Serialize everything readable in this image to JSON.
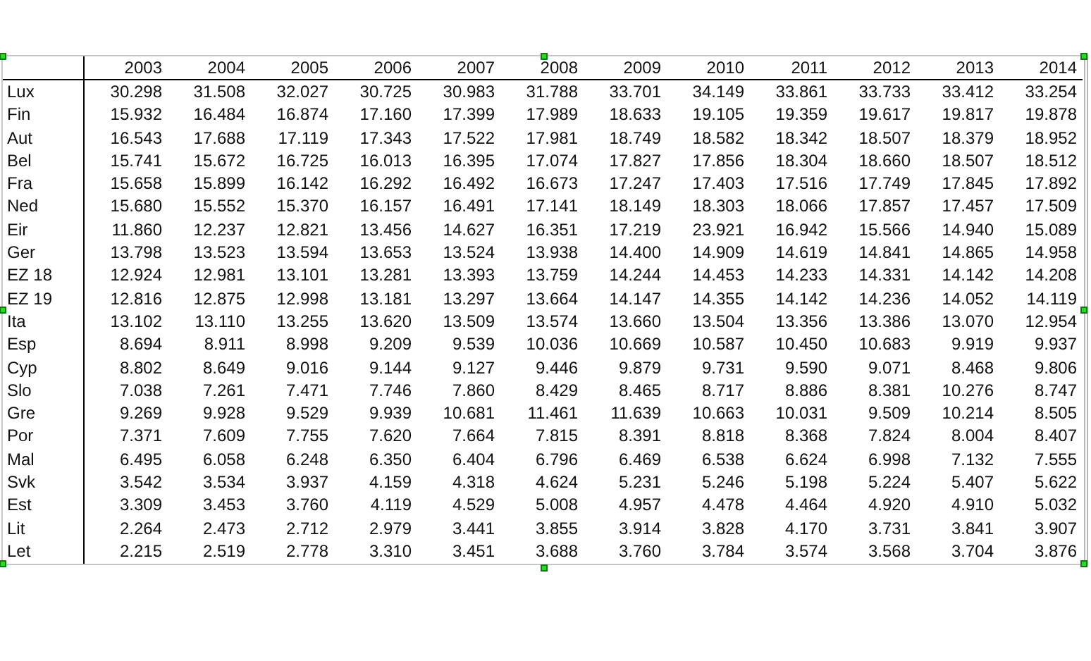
{
  "table": {
    "columns": [
      "2003",
      "2004",
      "2005",
      "2006",
      "2007",
      "2008",
      "2009",
      "2010",
      "2011",
      "2012",
      "2013",
      "2014"
    ],
    "rows": [
      {
        "label": "Lux",
        "cells": [
          "30.298",
          "31.508",
          "32.027",
          "30.725",
          "30.983",
          "31.788",
          "33.701",
          "34.149",
          "33.861",
          "33.733",
          "33.412",
          "33.254"
        ]
      },
      {
        "label": "Fin",
        "cells": [
          "15.932",
          "16.484",
          "16.874",
          "17.160",
          "17.399",
          "17.989",
          "18.633",
          "19.105",
          "19.359",
          "19.617",
          "19.817",
          "19.878"
        ]
      },
      {
        "label": "Aut",
        "cells": [
          "16.543",
          "17.688",
          "17.119",
          "17.343",
          "17.522",
          "17.981",
          "18.749",
          "18.582",
          "18.342",
          "18.507",
          "18.379",
          "18.952"
        ]
      },
      {
        "label": "Bel",
        "cells": [
          "15.741",
          "15.672",
          "16.725",
          "16.013",
          "16.395",
          "17.074",
          "17.827",
          "17.856",
          "18.304",
          "18.660",
          "18.507",
          "18.512"
        ]
      },
      {
        "label": "Fra",
        "cells": [
          "15.658",
          "15.899",
          "16.142",
          "16.292",
          "16.492",
          "16.673",
          "17.247",
          "17.403",
          "17.516",
          "17.749",
          "17.845",
          "17.892"
        ]
      },
      {
        "label": "Ned",
        "cells": [
          "15.680",
          "15.552",
          "15.370",
          "16.157",
          "16.491",
          "17.141",
          "18.149",
          "18.303",
          "18.066",
          "17.857",
          "17.457",
          "17.509"
        ]
      },
      {
        "label": "Eir",
        "cells": [
          "11.860",
          "12.237",
          "12.821",
          "13.456",
          "14.627",
          "16.351",
          "17.219",
          "23.921",
          "16.942",
          "15.566",
          "14.940",
          "15.089"
        ]
      },
      {
        "label": "Ger",
        "cells": [
          "13.798",
          "13.523",
          "13.594",
          "13.653",
          "13.524",
          "13.938",
          "14.400",
          "14.909",
          "14.619",
          "14.841",
          "14.865",
          "14.958"
        ]
      },
      {
        "label": "EZ 18",
        "cells": [
          "12.924",
          "12.981",
          "13.101",
          "13.281",
          "13.393",
          "13.759",
          "14.244",
          "14.453",
          "14.233",
          "14.331",
          "14.142",
          "14.208"
        ]
      },
      {
        "label": "EZ 19",
        "cells": [
          "12.816",
          "12.875",
          "12.998",
          "13.181",
          "13.297",
          "13.664",
          "14.147",
          "14.355",
          "14.142",
          "14.236",
          "14.052",
          "14.119"
        ]
      },
      {
        "label": "Ita",
        "cells": [
          "13.102",
          "13.110",
          "13.255",
          "13.620",
          "13.509",
          "13.574",
          "13.660",
          "13.504",
          "13.356",
          "13.386",
          "13.070",
          "12.954"
        ]
      },
      {
        "label": "Esp",
        "cells": [
          "8.694",
          "8.911",
          "8.998",
          "9.209",
          "9.539",
          "10.036",
          "10.669",
          "10.587",
          "10.450",
          "10.683",
          "9.919",
          "9.937"
        ]
      },
      {
        "label": "Cyp",
        "cells": [
          "8.802",
          "8.649",
          "9.016",
          "9.144",
          "9.127",
          "9.446",
          "9.879",
          "9.731",
          "9.590",
          "9.071",
          "8.468",
          "9.806"
        ]
      },
      {
        "label": "Slo",
        "cells": [
          "7.038",
          "7.261",
          "7.471",
          "7.746",
          "7.860",
          "8.429",
          "8.465",
          "8.717",
          "8.886",
          "8.381",
          "10.276",
          "8.747"
        ]
      },
      {
        "label": "Gre",
        "cells": [
          "9.269",
          "9.928",
          "9.529",
          "9.939",
          "10.681",
          "11.461",
          "11.639",
          "10.663",
          "10.031",
          "9.509",
          "10.214",
          "8.505"
        ]
      },
      {
        "label": "Por",
        "cells": [
          "7.371",
          "7.609",
          "7.755",
          "7.620",
          "7.664",
          "7.815",
          "8.391",
          "8.818",
          "8.368",
          "7.824",
          "8.004",
          "8.407"
        ]
      },
      {
        "label": "Mal",
        "cells": [
          "6.495",
          "6.058",
          "6.248",
          "6.350",
          "6.404",
          "6.796",
          "6.469",
          "6.538",
          "6.624",
          "6.998",
          "7.132",
          "7.555"
        ]
      },
      {
        "label": "Svk",
        "cells": [
          "3.542",
          "3.534",
          "3.937",
          "4.159",
          "4.318",
          "4.624",
          "5.231",
          "5.246",
          "5.198",
          "5.224",
          "5.407",
          "5.622"
        ]
      },
      {
        "label": "Est",
        "cells": [
          "3.309",
          "3.453",
          "3.760",
          "4.119",
          "4.529",
          "5.008",
          "4.957",
          "4.478",
          "4.464",
          "4.920",
          "4.910",
          "5.032"
        ]
      },
      {
        "label": "Lit",
        "cells": [
          "2.264",
          "2.473",
          "2.712",
          "2.979",
          "3.441",
          "3.855",
          "3.914",
          "3.828",
          "4.170",
          "3.731",
          "3.841",
          "3.907"
        ]
      },
      {
        "label": "Let",
        "cells": [
          "2.215",
          "2.519",
          "2.778",
          "3.310",
          "3.451",
          "3.688",
          "3.760",
          "3.784",
          "3.574",
          "3.568",
          "3.704",
          "3.876"
        ]
      }
    ]
  }
}
